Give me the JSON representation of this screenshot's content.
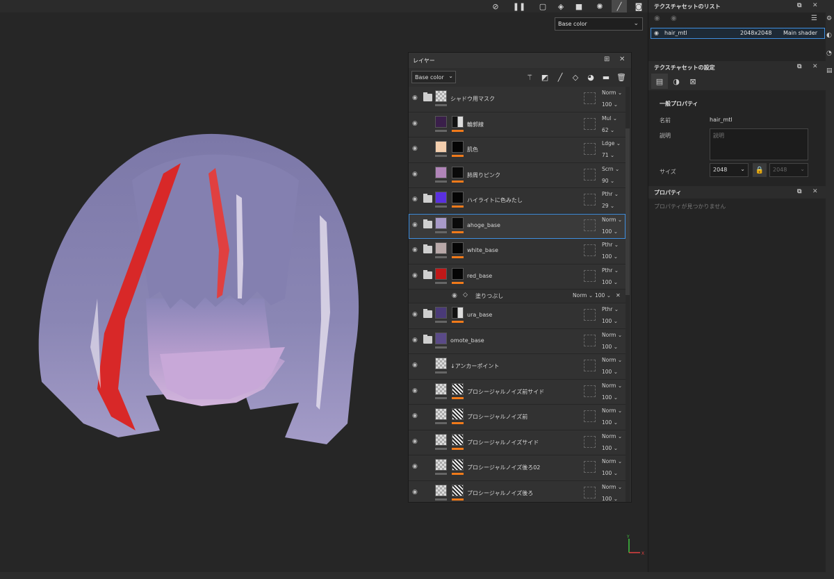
{
  "viewport": {
    "channel_select": "Base color",
    "toolbar_icons": [
      "eye-slash-icon",
      "pause-icon",
      "camera-mode-icon",
      "cube-icon",
      "video-icon",
      "paint-icon",
      "brush-icon",
      "screenshot-icon"
    ],
    "axis": {
      "y": "Y",
      "x": "X"
    }
  },
  "layers_panel": {
    "title": "レイヤー",
    "channel": "Base color",
    "tools": [
      "magic-wand-icon",
      "mask-icon",
      "brush-icon",
      "fill-icon",
      "material-icon",
      "folder-icon",
      "trash-icon"
    ],
    "layers": [
      {
        "name": "シャドウ用マスク",
        "type": "folder",
        "thumb": "checker",
        "mask": "",
        "blend": "Norm",
        "opacity": "100"
      },
      {
        "name": "輪郭線",
        "type": "paint",
        "thumb": "#3a1f4a",
        "mask": "mixed",
        "blend": "Mul",
        "opacity": "62"
      },
      {
        "name": "肌色",
        "type": "paint",
        "thumb": "#f4cfae",
        "mask": "#050505",
        "blend": "Ldge",
        "opacity": "71"
      },
      {
        "name": "肺周りピンク",
        "type": "paint",
        "thumb": "#b084b8",
        "mask": "#0a0a0a",
        "blend": "Scrn",
        "opacity": "90"
      },
      {
        "name": "ハイライトに色みたし",
        "type": "folder",
        "thumb": "#5a30e0",
        "mask": "#050505",
        "blend": "Pthr",
        "opacity": "29"
      },
      {
        "name": "ahoge_base",
        "type": "folder",
        "thumb": "#a89ac8",
        "mask": "#0a0a0a",
        "blend": "Norm",
        "opacity": "100",
        "selected": true
      },
      {
        "name": "white_base",
        "type": "folder",
        "thumb": "#b8a8a8",
        "mask": "#050505",
        "blend": "Pthr",
        "opacity": "100"
      },
      {
        "name": "red_base",
        "type": "folder",
        "thumb": "#c01818",
        "mask": "#050505",
        "blend": "Pthr",
        "opacity": "100"
      },
      {
        "name": "塗りつぶし",
        "type": "sub-fill",
        "blend": "Norm",
        "opacity": "100"
      },
      {
        "name": "ura_base",
        "type": "folder",
        "thumb": "#4a3a78",
        "mask": "mixed",
        "blend": "Pthr",
        "opacity": "100"
      },
      {
        "name": "omote_base",
        "type": "folder",
        "thumb": "#5a4a88",
        "mask": "",
        "blend": "Norm",
        "opacity": "100"
      },
      {
        "name": "↓アンカーポイント",
        "type": "paint",
        "thumb": "checker",
        "mask": "",
        "blend": "Norm",
        "opacity": "100"
      },
      {
        "name": "プロシージャルノイズ前サイド",
        "type": "paint",
        "thumb": "checker",
        "mask": "noise",
        "blend": "Norm",
        "opacity": "100"
      },
      {
        "name": "プロシージャルノイズ前",
        "type": "paint",
        "thumb": "checker",
        "mask": "noise",
        "blend": "Norm",
        "opacity": "100"
      },
      {
        "name": "プロシージャルノイズサイド",
        "type": "paint",
        "thumb": "checker",
        "mask": "noise",
        "blend": "Norm",
        "opacity": "100"
      },
      {
        "name": "プロシージャルノイズ後ろ02",
        "type": "paint",
        "thumb": "checker",
        "mask": "noise",
        "blend": "Norm",
        "opacity": "100"
      },
      {
        "name": "プロシージャルノイズ後ろ",
        "type": "paint",
        "thumb": "checker",
        "mask": "noise",
        "blend": "Norm",
        "opacity": "100"
      }
    ]
  },
  "texture_set_list": {
    "title": "テクスチャセットのリスト",
    "row": {
      "name": "hair_mtl",
      "size": "2048x2048",
      "shader": "Main shader"
    }
  },
  "texture_set_settings": {
    "title": "テクスチャセットの設定",
    "section": "一般プロパティ",
    "name_label": "名前",
    "name_value": "hair_mtl",
    "desc_label": "説明",
    "desc_placeholder": "説明",
    "size_label": "サイズ",
    "size_value": "2048",
    "size_value2": "2048"
  },
  "properties": {
    "title": "プロパティ",
    "empty": "プロパティが見つかりません"
  }
}
